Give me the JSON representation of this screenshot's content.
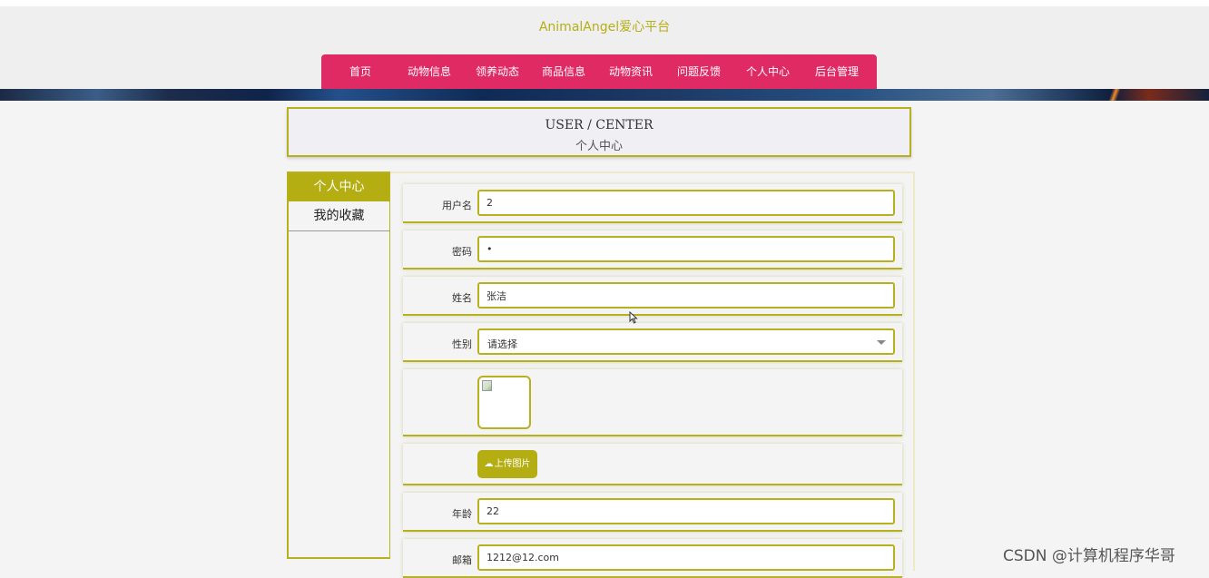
{
  "header": {
    "site_title": "AnimalAngel爱心平台"
  },
  "nav": {
    "items": [
      "首页",
      "动物信息",
      "领养动态",
      "商品信息",
      "动物资讯",
      "问题反馈",
      "个人中心",
      "后台管理"
    ]
  },
  "page_head": {
    "title_en": "USER / CENTER",
    "title_cn": "个人中心"
  },
  "sidebar": {
    "items": [
      {
        "label": "个人中心",
        "active": true
      },
      {
        "label": "我的收藏",
        "active": false
      }
    ]
  },
  "form": {
    "username": {
      "label": "用户名",
      "value": "2"
    },
    "password": {
      "label": "密码",
      "value": "•"
    },
    "name": {
      "label": "姓名",
      "value": "张洁"
    },
    "gender": {
      "label": "性别",
      "value": "请选择"
    },
    "upload_label": "上传图片",
    "age": {
      "label": "年龄",
      "value": "22"
    },
    "email": {
      "label": "邮箱",
      "value": "1212@12.com"
    }
  },
  "watermark": "CSDN @计算机程序华哥",
  "colors": {
    "accent": "#b5ae12",
    "nav_bg": "#df2a64",
    "title": "#b5ae18"
  }
}
